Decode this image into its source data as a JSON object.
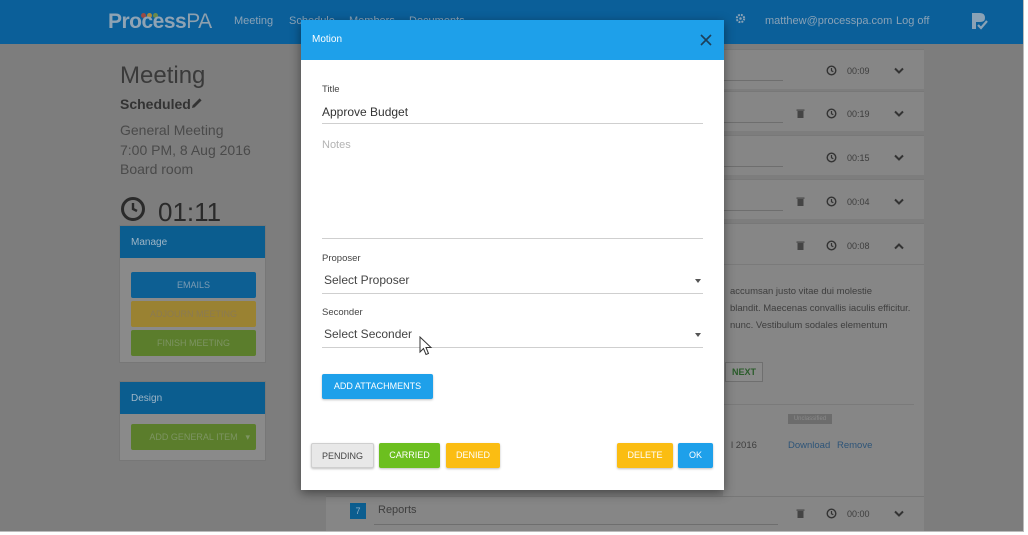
{
  "topbar": {
    "logo_main": "Process",
    "logo_sub": "PA",
    "nav_items": [
      "Meeting",
      "Schedule",
      "Members",
      "Documents"
    ],
    "user_email": "matthew@processpa.com",
    "logout_label": "Log off",
    "logo_dot_colors": [
      "#c0392b",
      "#e6a01e",
      "#6e9b2e"
    ]
  },
  "meeting": {
    "title": "Meeting",
    "status": "Scheduled",
    "type": "General Meeting",
    "datetime": "7:00 PM, 8 Aug 2016",
    "location": "Board room",
    "timer": "01:11"
  },
  "manage_panel": {
    "title": "Manage",
    "buttons": [
      "EMAILS",
      "ADJOURN MEETING",
      "FINISH MEETING"
    ]
  },
  "design_panel": {
    "title": "Design",
    "add_button": "ADD GENERAL ITEM",
    "add_caret": "▾"
  },
  "agenda_times": [
    "00:09",
    "00:19",
    "00:15",
    "00:04",
    "00:08"
  ],
  "agenda_text": [
    "accumsan justo vitae dui molestie",
    "blandit. Maecenas convallis iaculis efficitur.",
    "nunc. Vestibulum sodales elementum"
  ],
  "agenda_next": "NEXT",
  "attachment": {
    "badge": "Unclassified",
    "date_tail": "l 2016",
    "download": "Download",
    "remove": "Remove"
  },
  "reports_row": {
    "number": "7",
    "label": "Reports",
    "time": "00:00"
  },
  "dialog": {
    "header": "Motion",
    "title_label": "Title",
    "title_value": "Approve Budget",
    "notes_placeholder": "Notes",
    "proposer_label": "Proposer",
    "proposer_value": "Select Proposer",
    "seconder_label": "Seconder",
    "seconder_value": "Select Seconder",
    "attachments_button": "ADD ATTACHMENTS",
    "status_buttons": {
      "pending": "PENDING",
      "carried": "CARRIED",
      "denied": "DENIED"
    },
    "delete_button": "DELETE",
    "ok_button": "OK"
  },
  "colors": {
    "dialog_header": "#1ea0ea",
    "primary": "#1ea0ea",
    "carried": "#6cbf1f",
    "denied": "#fbbd12",
    "delete": "#fbbd12",
    "pending": "#e8e8e8"
  }
}
